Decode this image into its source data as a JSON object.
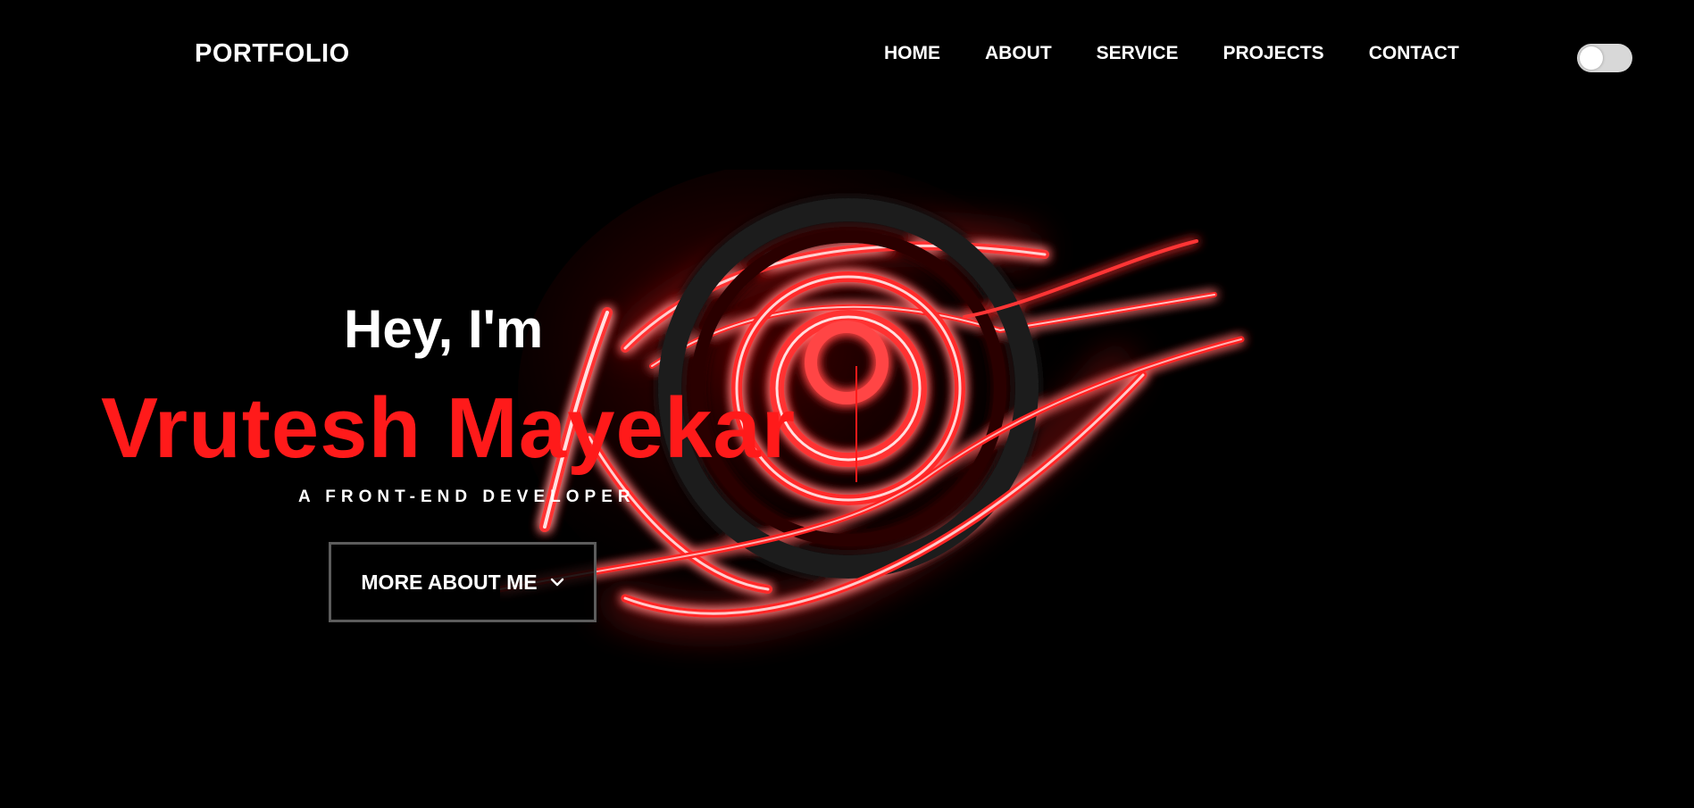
{
  "nav": {
    "logo": "PORTFOLIO",
    "items": [
      {
        "label": "HOME"
      },
      {
        "label": "ABOUT"
      },
      {
        "label": "SERVICE"
      },
      {
        "label": "PROJECTS"
      },
      {
        "label": "CONTACT"
      }
    ],
    "theme_toggle": {
      "icon": "theme-toggle-switch",
      "state": "off"
    }
  },
  "hero": {
    "greeting": "Hey, I'm",
    "name": "Vrutesh Mayekar",
    "subtitle": "A FRONT-END DEVELOPER",
    "cta": {
      "label": "MORE ABOUT ME",
      "icon": "chevron-down-icon"
    }
  },
  "colors": {
    "background": "#000000",
    "accent": "#ff1a1a",
    "text": "#ffffff",
    "button_border": "#5c5c5c"
  }
}
